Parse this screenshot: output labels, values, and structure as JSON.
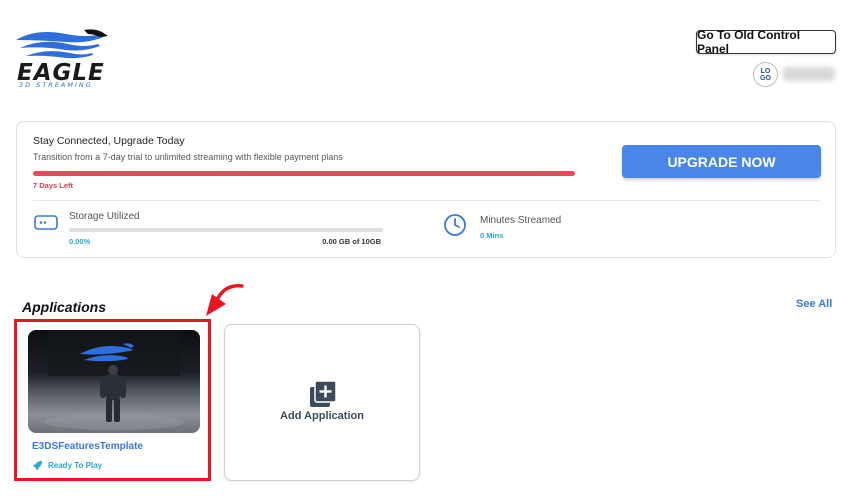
{
  "brand": {
    "name": "EAGLE",
    "tagline": "3D STREAMING",
    "color": "#2f6fdd"
  },
  "header": {
    "old_panel_label": "Go To Old Control Panel",
    "avatar_line1": "LO",
    "avatar_line2": "GO"
  },
  "upgrade": {
    "title": "Stay Connected, Upgrade Today",
    "subtitle": "Transition from a 7-day trial to unlimited streaming with flexible payment plans",
    "days_left": "7 Days Left",
    "trial_remaining_fraction": 1.0,
    "button_label": "UPGRADE NOW",
    "accent_color": "#4a86e8",
    "warning_color": "#ee4458"
  },
  "storage": {
    "label": "Storage Utilized",
    "percent_text": "0.00%",
    "percent_value": 0,
    "amount_text": "0.00 GB of 10GB",
    "icon": "hard-drive-icon"
  },
  "minutes": {
    "label": "Minutes Streamed",
    "value_text": "0 Mins",
    "icon": "clock-icon"
  },
  "applications": {
    "title": "Applications",
    "see_all_label": "See All",
    "items": [
      {
        "name": "E3DSFeaturesTemplate",
        "status": "Ready To Play",
        "status_icon": "rocket-icon"
      }
    ],
    "add_label": "Add Application",
    "add_icon": "add-layers-icon"
  }
}
